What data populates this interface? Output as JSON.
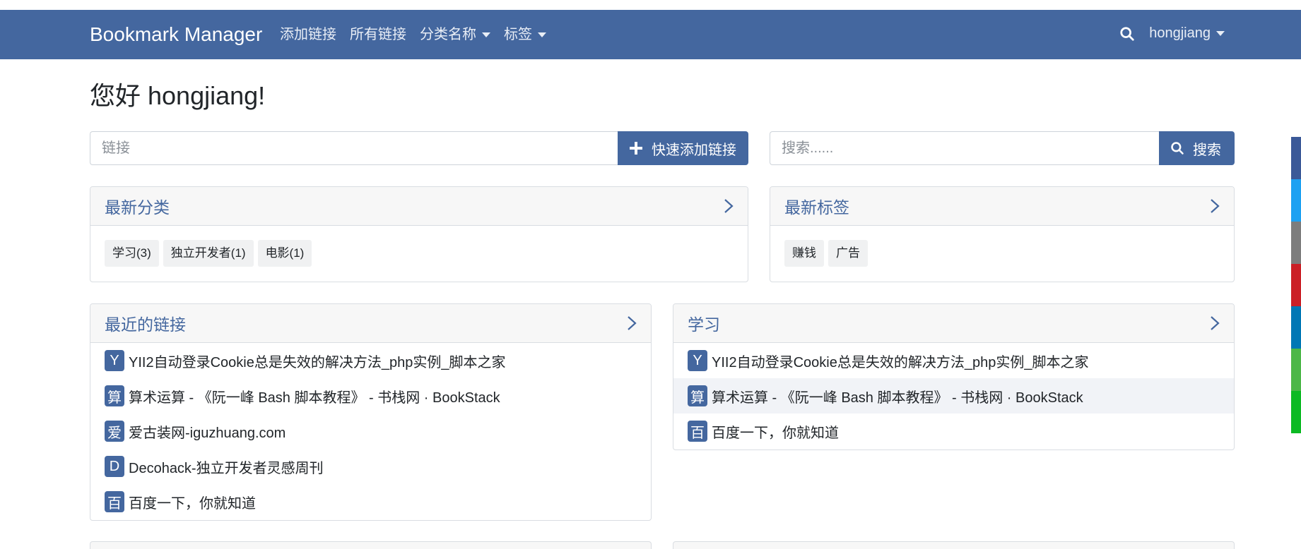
{
  "navbar": {
    "brand": "Bookmark Manager",
    "links": [
      {
        "label": "添加链接",
        "dropdown": false
      },
      {
        "label": "所有链接",
        "dropdown": false
      },
      {
        "label": "分类名称",
        "dropdown": true
      },
      {
        "label": "标签",
        "dropdown": true
      }
    ],
    "user": "hongjiang",
    "search_icon": "search-icon"
  },
  "greeting": "您好 hongjiang!",
  "quick_add": {
    "placeholder": "链接",
    "button_label": "快速添加链接",
    "button_icon": "plus-icon"
  },
  "search": {
    "placeholder": "搜索......",
    "button_label": "搜索",
    "button_icon": "search-icon"
  },
  "latest_categories": {
    "title": "最新分类",
    "items": [
      "学习(3)",
      "独立开发者(1)",
      "电影(1)"
    ]
  },
  "latest_tags": {
    "title": "最新标签",
    "items": [
      "赚钱",
      "广告"
    ]
  },
  "recent_links": {
    "title": "最近的链接",
    "items": [
      {
        "avatar": "Y",
        "title": "YII2自动登录Cookie总是失效的解决方法_php实例_脚本之家"
      },
      {
        "avatar": "算",
        "title": "算术运算 - 《阮一峰 Bash 脚本教程》 - 书栈网 · BookStack"
      },
      {
        "avatar": "爱",
        "title": "爱古装网-iguzhuang.com"
      },
      {
        "avatar": "D",
        "title": "Decohack-独立开发者灵感周刊"
      },
      {
        "avatar": "百",
        "title": "百度一下，你就知道"
      }
    ]
  },
  "study_links": {
    "title": "学习",
    "items": [
      {
        "avatar": "Y",
        "title": "YII2自动登录Cookie总是失效的解决方法_php实例_脚本之家"
      },
      {
        "avatar": "算",
        "title": "算术运算 - 《阮一峰 Bash 脚本教程》 - 书栈网 · BookStack"
      },
      {
        "avatar": "百",
        "title": "百度一下，你就知道"
      }
    ]
  },
  "colors": {
    "primary": "#44679f",
    "side_strip": [
      "#3b5998",
      "#1da1f2",
      "#7d7d7d",
      "#cb2027",
      "#0077b5",
      "#4cb748",
      "#0cba23"
    ]
  }
}
